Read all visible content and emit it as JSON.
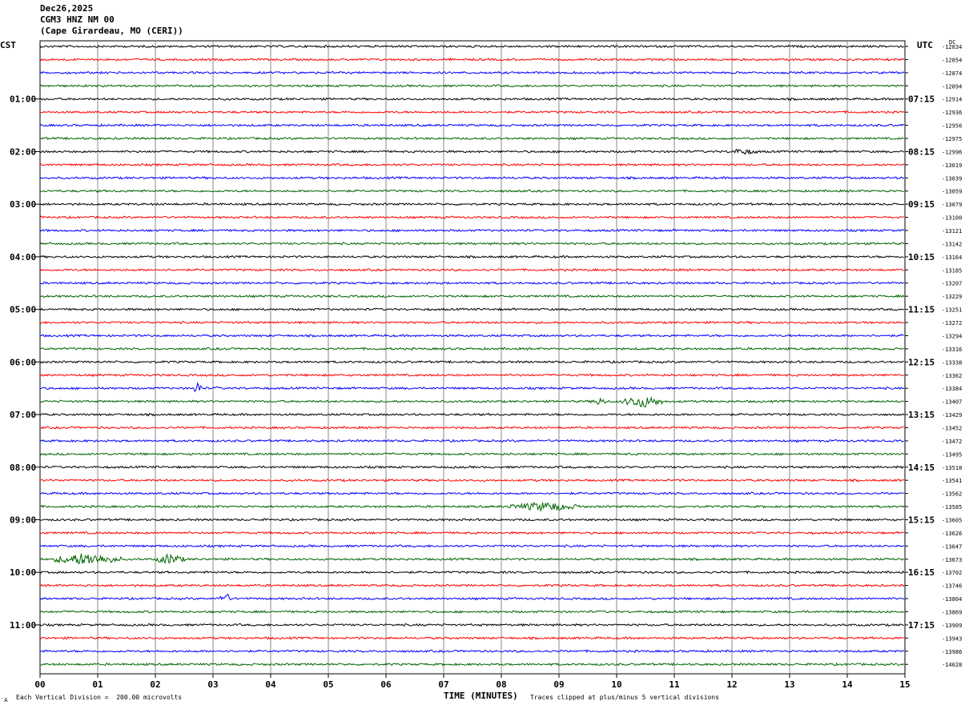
{
  "header": {
    "date": "Dec26,2025",
    "station": "CGM3 HNZ NM 00",
    "location": "(Cape Girardeau, MO (CERI))"
  },
  "axes": {
    "left_timezone": "CST",
    "right_timezone": "UTC",
    "dc_label": "DC"
  },
  "footer": {
    "scale_note": "Each Vertical Division =  200.00 microvolts",
    "xlabel": "TIME (MINUTES)",
    "clip_note": "Traces clipped at plus/minus 5 vertical divisions",
    "corner_mark": "′A"
  },
  "chart_data": {
    "type": "line",
    "title": "CGM3 HNZ NM 00",
    "xlabel": "TIME (MINUTES)",
    "xlim": [
      0,
      15
    ],
    "x_ticks": [
      "00",
      "01",
      "02",
      "03",
      "04",
      "05",
      "06",
      "07",
      "08",
      "09",
      "10",
      "11",
      "12",
      "13",
      "14",
      "15"
    ],
    "trace_colors": [
      "#000000",
      "#ff0000",
      "#0000ff",
      "#006400"
    ],
    "trace_minutes": 15,
    "grid": true,
    "left_hour_labels": [
      {
        "label": "01:00",
        "trace_index": 4
      },
      {
        "label": "02:00",
        "trace_index": 8
      },
      {
        "label": "03:00",
        "trace_index": 12
      },
      {
        "label": "04:00",
        "trace_index": 16
      },
      {
        "label": "05:00",
        "trace_index": 20
      },
      {
        "label": "06:00",
        "trace_index": 24
      },
      {
        "label": "07:00",
        "trace_index": 28
      },
      {
        "label": "08:00",
        "trace_index": 32
      },
      {
        "label": "09:00",
        "trace_index": 36
      },
      {
        "label": "10:00",
        "trace_index": 40
      },
      {
        "label": "11:00",
        "trace_index": 44
      }
    ],
    "right_hour_labels": [
      {
        "label": "07:15",
        "trace_index": 4
      },
      {
        "label": "08:15",
        "trace_index": 8
      },
      {
        "label": "09:15",
        "trace_index": 12
      },
      {
        "label": "10:15",
        "trace_index": 16
      },
      {
        "label": "11:15",
        "trace_index": 20
      },
      {
        "label": "12:15",
        "trace_index": 24
      },
      {
        "label": "13:15",
        "trace_index": 28
      },
      {
        "label": "14:15",
        "trace_index": 32
      },
      {
        "label": "15:15",
        "trace_index": 36
      },
      {
        "label": "16:15",
        "trace_index": 40
      },
      {
        "label": "17:15",
        "trace_index": 44
      }
    ],
    "dc_offsets": [
      "-12834",
      "-12854",
      "-12874",
      "-12894",
      "-12914",
      "-12936",
      "-12956",
      "-12975",
      "-12996",
      "-13019",
      "-13039",
      "-13059",
      "-13079",
      "-13100",
      "-13121",
      "-13142",
      "-13164",
      "-13185",
      "-13207",
      "-13229",
      "-13251",
      "-13272",
      "-13294",
      "-13316",
      "-13338",
      "-13362",
      "-13384",
      "-13407",
      "-13429",
      "-13452",
      "-13472",
      "-13495",
      "-13518",
      "-13541",
      "-13562",
      "-13585",
      "-13605",
      "-13626",
      "-13647",
      "-13673",
      "-13702",
      "-13746",
      "-13804",
      "-13869",
      "-13909",
      "-13943",
      "-13986",
      "-14028"
    ],
    "events": [
      {
        "trace_index": 8,
        "start_min": 11.9,
        "end_min": 12.5,
        "amplitude": 4
      },
      {
        "trace_index": 26,
        "start_min": 2.65,
        "end_min": 2.8,
        "amplitude": 10
      },
      {
        "trace_index": 26,
        "start_min": 3.05,
        "end_min": 3.12,
        "amplitude": 3
      },
      {
        "trace_index": 27,
        "start_min": 9.55,
        "end_min": 9.85,
        "amplitude": 5
      },
      {
        "trace_index": 27,
        "start_min": 10.1,
        "end_min": 10.8,
        "amplitude": 8
      },
      {
        "trace_index": 35,
        "start_min": 8.1,
        "end_min": 9.4,
        "amplitude": 6
      },
      {
        "trace_index": 39,
        "start_min": 0.2,
        "end_min": 1.4,
        "amplitude": 8
      },
      {
        "trace_index": 39,
        "start_min": 2.0,
        "end_min": 2.5,
        "amplitude": 7
      },
      {
        "trace_index": 42,
        "start_min": 3.1,
        "end_min": 3.3,
        "amplitude": 9
      }
    ]
  }
}
